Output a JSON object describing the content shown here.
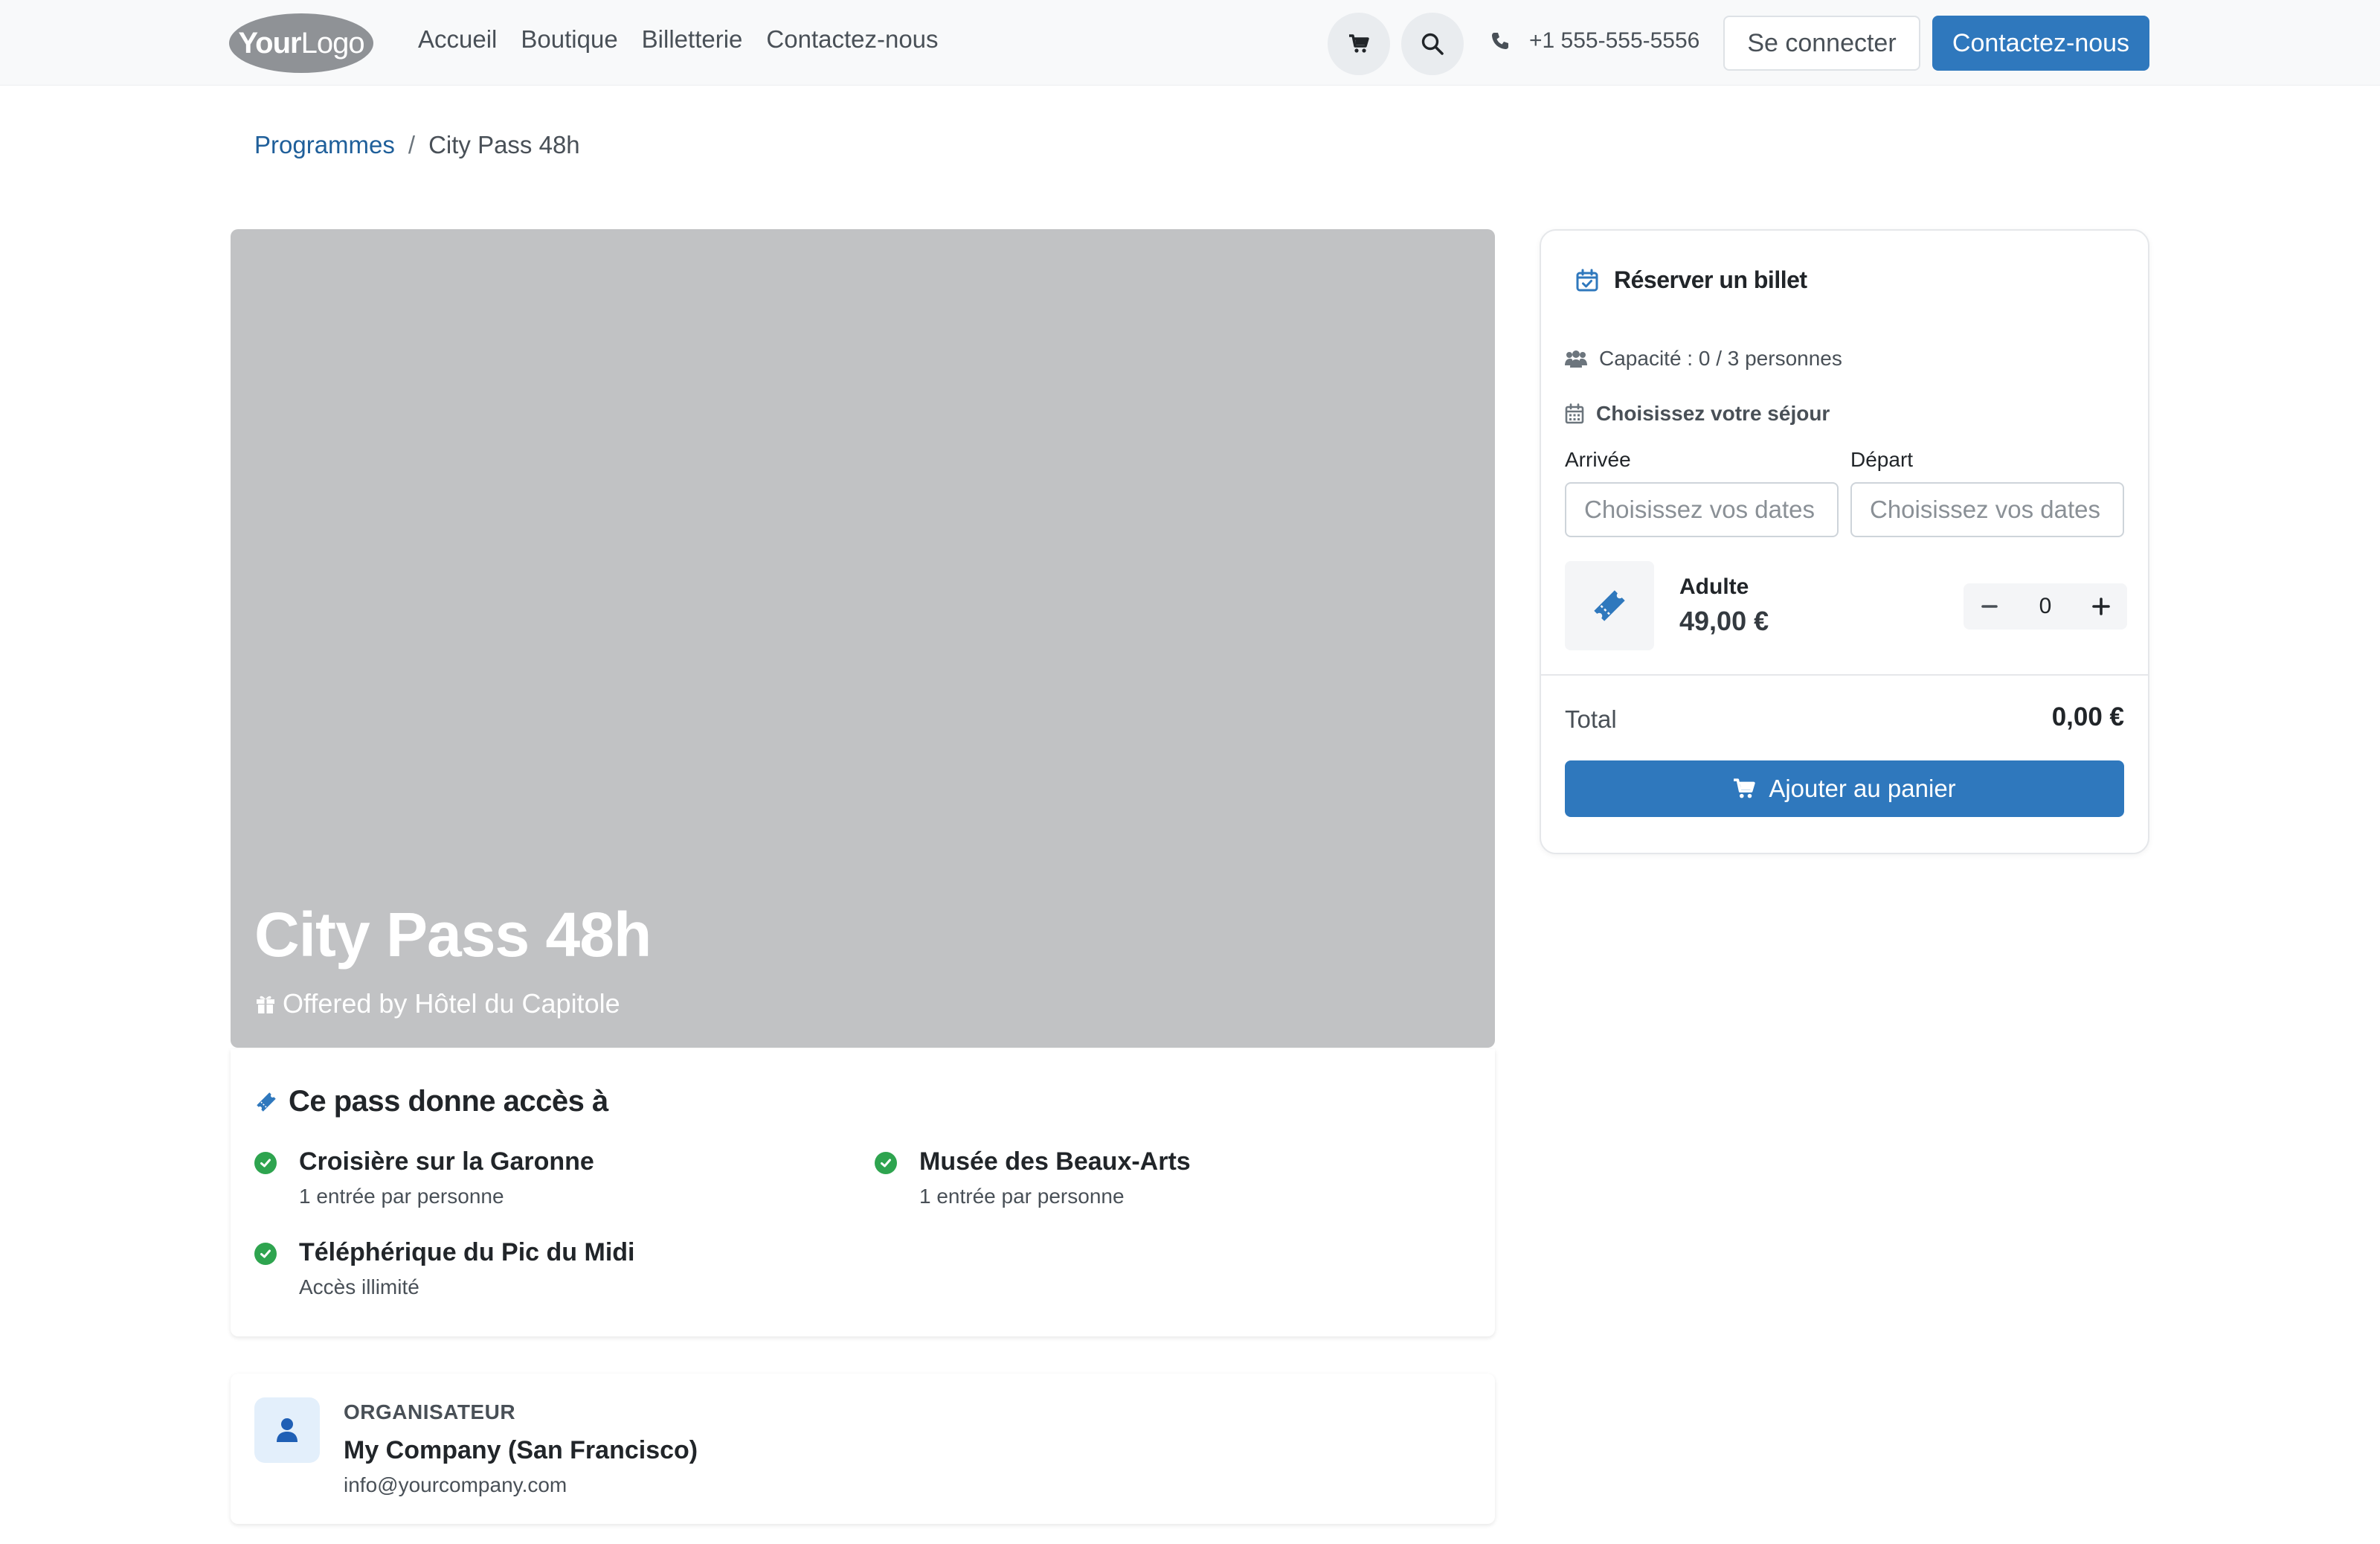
{
  "header": {
    "logo": {
      "bold": "Your",
      "light": "Logo"
    },
    "nav": [
      "Accueil",
      "Boutique",
      "Billetterie",
      "Contactez-nous"
    ],
    "phone": "+1 555-555-5556",
    "login_label": "Se connecter",
    "contact_label": "Contactez-nous"
  },
  "breadcrumb": {
    "parent": "Programmes",
    "separator": "/",
    "current": "City Pass 48h"
  },
  "hero": {
    "title": "City Pass 48h",
    "subtitle": "Offered by Hôtel du Capitole"
  },
  "access": {
    "title": "Ce pass donne accès à",
    "items": [
      {
        "name": "Croisière sur la Garonne",
        "desc": "1 entrée par personne"
      },
      {
        "name": "Musée des Beaux-Arts",
        "desc": "1 entrée par personne"
      },
      {
        "name": "Téléphérique du Pic du Midi",
        "desc": "Accès illimité"
      }
    ]
  },
  "organizer": {
    "label": "ORGANISATEUR",
    "name": "My Company (San Francisco)",
    "email": "info@yourcompany.com"
  },
  "booking": {
    "title": "Réserver un billet",
    "capacity": "Capacité : 0 / 3 personnes",
    "stay_label": "Choisissez votre séjour",
    "arrival_label": "Arrivée",
    "departure_label": "Départ",
    "arrival_placeholder": "Choisissez vos dates",
    "departure_placeholder": "Choisissez vos dates",
    "ticket": {
      "name": "Adulte",
      "price": "49,00 €",
      "quantity": "0"
    },
    "total_label": "Total",
    "total_value": "0,00 €",
    "add_to_cart_label": "Ajouter au panier"
  },
  "colors": {
    "primary": "#2f78bd",
    "success": "#2ea44f",
    "hero_bg": "#c1c2c4",
    "header_bg": "#f8f9fa"
  }
}
